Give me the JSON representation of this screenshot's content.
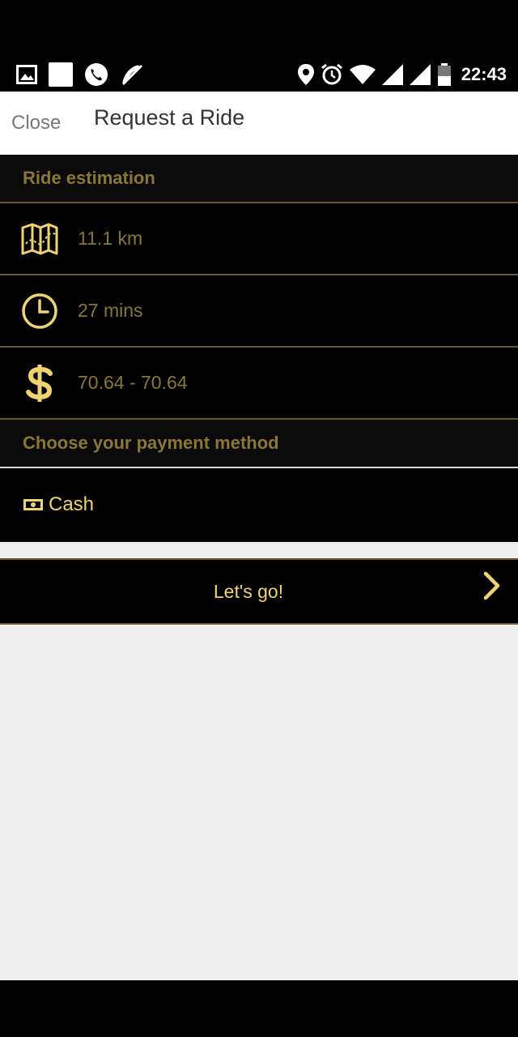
{
  "status_bar": {
    "time": "22:43",
    "left_icons": [
      "image-icon",
      "square-icon",
      "phone-icon",
      "muted-mic-icon"
    ],
    "right_icons": [
      "location-icon",
      "alarm-icon",
      "wifi-icon",
      "signal-icon",
      "signal-icon",
      "battery-icon"
    ]
  },
  "header": {
    "close_label": "Close",
    "title": "Request a Ride"
  },
  "estimation": {
    "title": "Ride estimation",
    "distance": "11.1 km",
    "duration": "27 mins",
    "price": "70.64 - 70.64"
  },
  "payment": {
    "title": "Choose your payment method",
    "method": "Cash"
  },
  "action": {
    "label": "Let's go!"
  },
  "colors": {
    "gold": "#f0d36e",
    "muted_gold": "#8a7733",
    "divider": "#6b5a25",
    "background": "#000000",
    "empty_area": "#eeeeee"
  }
}
